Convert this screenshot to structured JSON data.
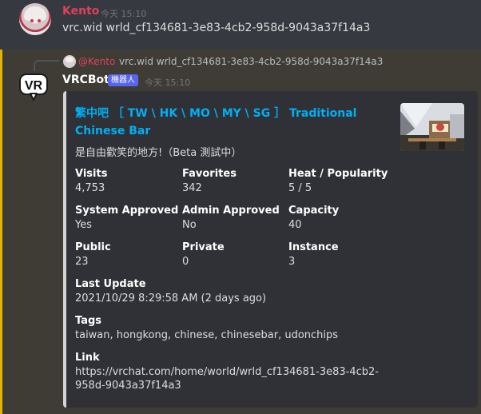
{
  "message1": {
    "author": "Kento",
    "time": "今天 15:10",
    "content": "vrc.wid wrld_cf134681-3e83-4cb2-958d-9043a37f14a3"
  },
  "message2": {
    "reply": {
      "author": "@Kento",
      "text": "vrc.wid wrld_cf134681-3e83-4cb2-958d-9043a37f14a3"
    },
    "author": "VRCBot",
    "tag": "機器人",
    "time": "今天 15:10",
    "accent_color": "#e4b400",
    "embed": {
      "title": "繁中吧 ［ TW \\ HK \\ MO \\ MY \\ SG ］ Traditional Chinese Bar",
      "description": "是自由歡笑的地方!（Beta 測試中）",
      "fields": {
        "visits": {
          "name": "Visits",
          "value": "4,753"
        },
        "favorites": {
          "name": "Favorites",
          "value": "342"
        },
        "heat": {
          "name": "Heat / Popularity",
          "value": "5 / 5"
        },
        "system_approved": {
          "name": "System Approved",
          "value": "Yes"
        },
        "admin_approved": {
          "name": "Admin Approved",
          "value": "No"
        },
        "capacity": {
          "name": "Capacity",
          "value": "40"
        },
        "public": {
          "name": "Public",
          "value": "23"
        },
        "private": {
          "name": "Private",
          "value": "0"
        },
        "instance": {
          "name": "Instance",
          "value": "3"
        },
        "last_update": {
          "name": "Last Update",
          "value": "2021/10/29 8:29:58 AM (2 days ago)"
        },
        "tags": {
          "name": "Tags",
          "value": "taiwan, hongkong, chinese, chinesebar, udonchips"
        },
        "link": {
          "name": "Link",
          "line1": "https://vrchat.com/home/world/wrld_cf134681-3e83-4cb2-",
          "line2": "958d-9043a37f14a3"
        }
      }
    }
  }
}
